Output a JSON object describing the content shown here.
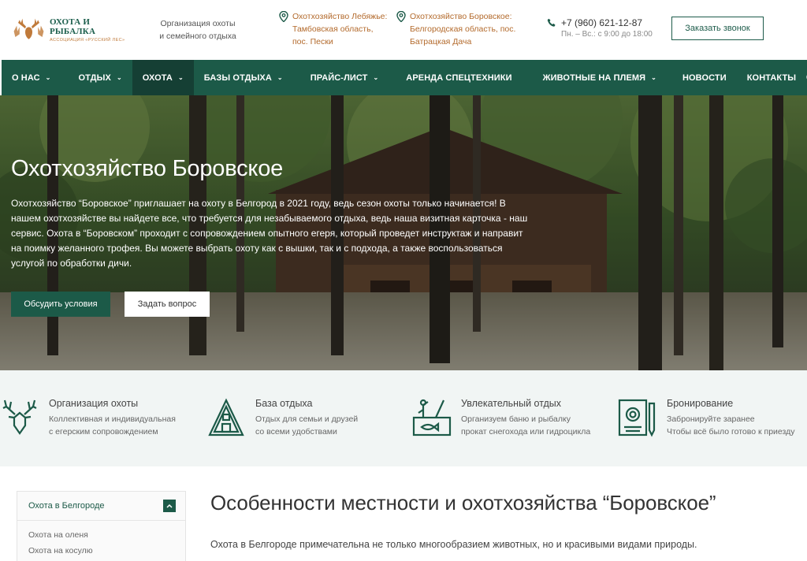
{
  "header": {
    "logo_title": "ОХОТА И РЫБАЛКА",
    "logo_subtitle": "АССОЦИАЦИЯ «РУССКИЙ ЛЕС»",
    "org_line1": "Организация охоты",
    "org_line2": "и семейного отдыха",
    "locations": [
      {
        "line1": "Охотхозяйство Лебяжье:",
        "line2": "Тамбовская область,",
        "line3": "пос. Пески"
      },
      {
        "line1": "Охотхозяйство Боровское:",
        "line2": "Белгородская область, пос.",
        "line3": "Батрацкая Дача"
      }
    ],
    "phone": "+7 (960) 621-12-87",
    "hours": "Пн. – Вс.: с 9:00 до 18:00",
    "callback_label": "Заказать звонок"
  },
  "nav": {
    "items": [
      {
        "label": "О НАС"
      },
      {
        "label": "ОТДЫХ"
      },
      {
        "label": "ОХОТА"
      },
      {
        "label": "БАЗЫ ОТДЫХА"
      },
      {
        "label": "ПРАЙС-ЛИСТ"
      },
      {
        "label": "АРЕНДА СПЕЦТЕХНИКИ"
      },
      {
        "label": "ЖИВОТНЫЕ НА ПЛЕМЯ"
      },
      {
        "label": "НОВОСТИ"
      },
      {
        "label": "КОНТАКТЫ"
      }
    ]
  },
  "hero": {
    "title": "Охотхозяйство Боровское",
    "text": "Охотхозяйство “Боровское” приглашает на охоту в Белгород в 2021 году, ведь сезон охоты только начинается! В нашем охотхозяйстве вы найдете все, что требуется для незабываемого отдыха, ведь наша визитная карточка - наш сервис. Охота в “Боровском” проходит с сопровождением опытного егеря, который проведет инструктаж и направит на поимку желанного трофея. Вы можете выбрать охоту как с вышки, так и с подхода, а также воспользоваться услугой по обработки дичи.",
    "btn_primary": "Обсудить условия",
    "btn_secondary": "Задать вопрос"
  },
  "features": [
    {
      "title": "Организация охоты",
      "desc1": "Коллективная и индивидуальная",
      "desc2": "с егерским сопровождением",
      "icon": "deer-icon"
    },
    {
      "title": "База отдыха",
      "desc1": "Отдых для семьи и друзей",
      "desc2": "со всеми удобствами",
      "icon": "cabin-icon"
    },
    {
      "title": "Увлекательный отдых",
      "desc1": "Организуем баню и рыбалку",
      "desc2": "прокат снегохода или гидроцикла",
      "icon": "fishing-icon"
    },
    {
      "title": "Бронирование",
      "desc1": "Забронируйте заранее",
      "desc2": "Чтобы всё было готово к приезду",
      "icon": "certificate-icon"
    }
  ],
  "sidebar": {
    "heading": "Охота в Белгороде",
    "items": [
      "Охота на оленя",
      "Охота на косулю"
    ]
  },
  "content": {
    "title": "Особенности местности и охотхозяйства “Боровское”",
    "paragraph": "Охота в Белгороде примечательна не только многообразием животных, но и красивыми видами природы."
  },
  "colors": {
    "brand_green": "#1c5a48",
    "nav_active": "#153f34",
    "accent_brown": "#b36a2c"
  }
}
